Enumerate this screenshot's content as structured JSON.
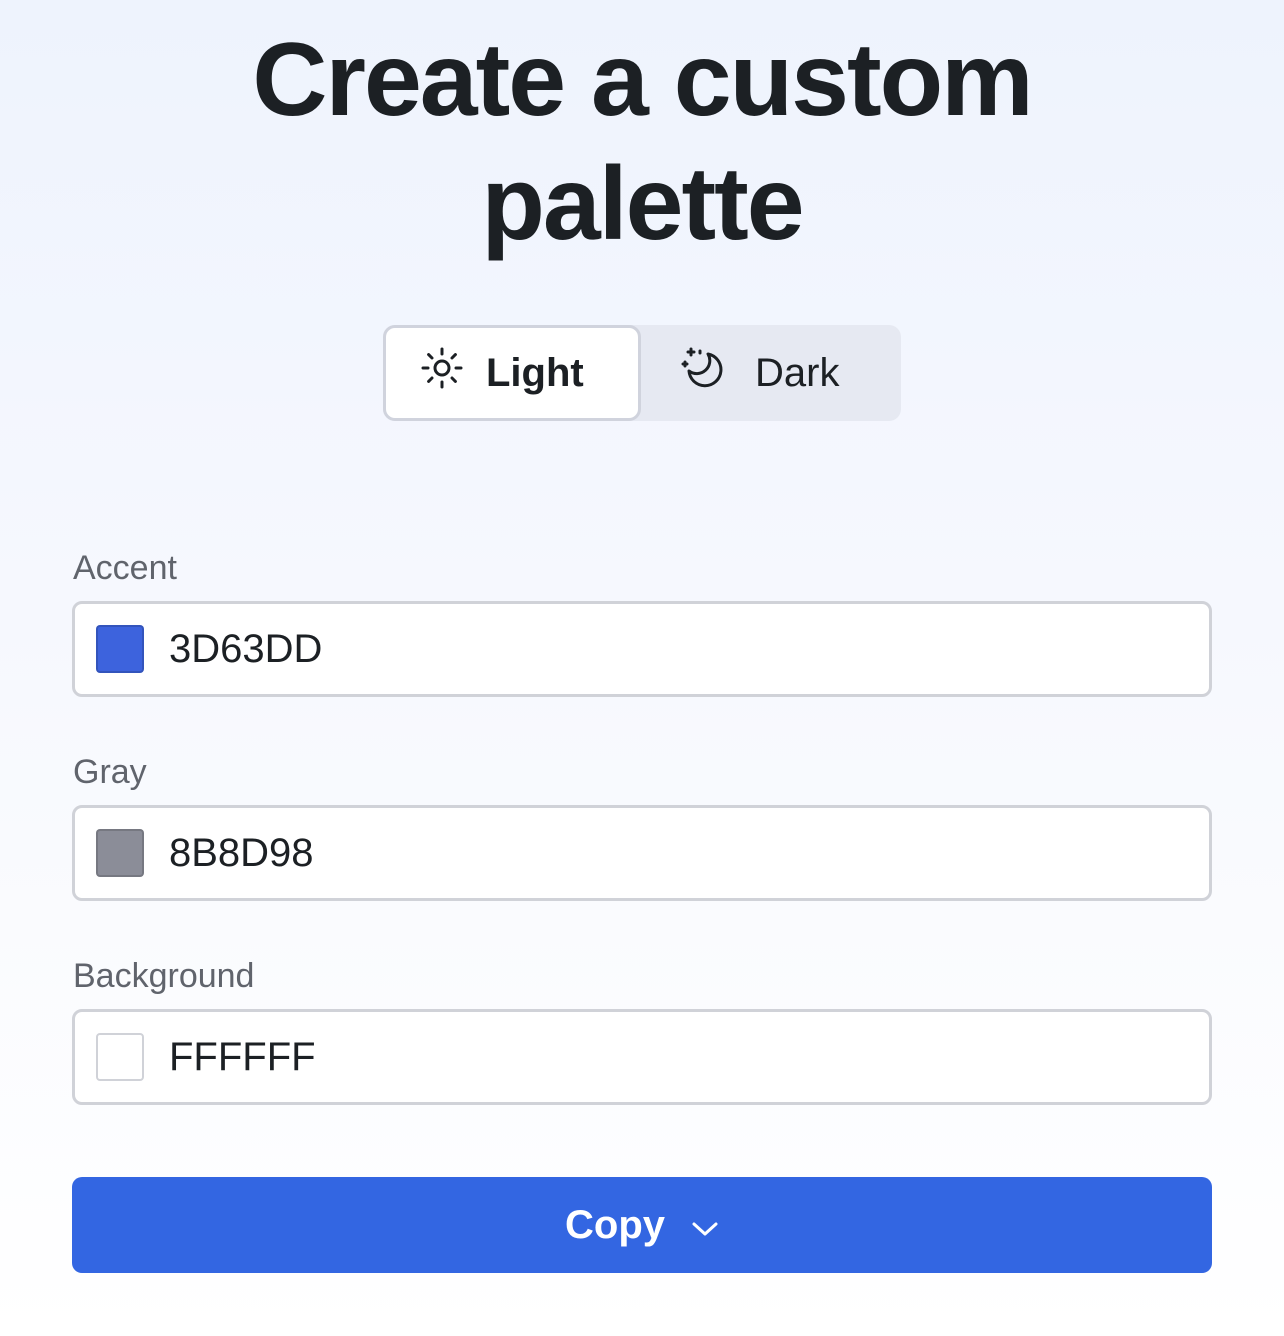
{
  "header": {
    "title_line1": "Create a custom",
    "title_line2": "palette"
  },
  "appearance_toggle": {
    "selected": "Light",
    "options": [
      {
        "label": "Light",
        "icon": "sun-icon"
      },
      {
        "label": "Dark",
        "icon": "moon-stars-icon"
      }
    ]
  },
  "fields": {
    "accent": {
      "label": "Accent",
      "value": "3D63DD",
      "swatch_color": "#3D63DD"
    },
    "gray": {
      "label": "Gray",
      "value": "8B8D98",
      "swatch_color": "#8B8D98"
    },
    "background": {
      "label": "Background",
      "value": "FFFFFF",
      "swatch_color": "#FFFFFF"
    }
  },
  "copy_button": {
    "label": "Copy",
    "icon": "chevron-down-icon",
    "color": "#3366E2"
  }
}
